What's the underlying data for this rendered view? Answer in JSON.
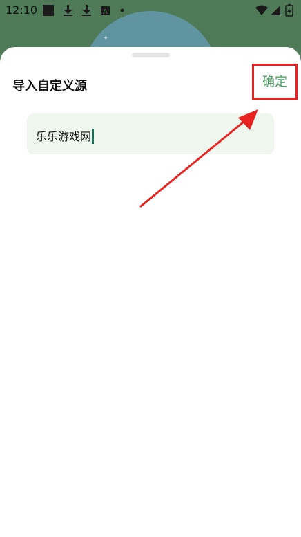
{
  "status_bar": {
    "time": "12:10"
  },
  "sheet": {
    "title": "导入自定义源",
    "confirm_label": "确定",
    "input": {
      "value": "乐乐游戏网"
    }
  },
  "colors": {
    "accent": "#4b9d63",
    "annotation_red": "#e8231f",
    "input_bg": "#eef6ee"
  },
  "icons": [
    "notification-square-icon",
    "download-icon",
    "download-icon",
    "font-app-icon",
    "dot-icon",
    "wifi-icon",
    "signal-icon",
    "battery-icon"
  ]
}
